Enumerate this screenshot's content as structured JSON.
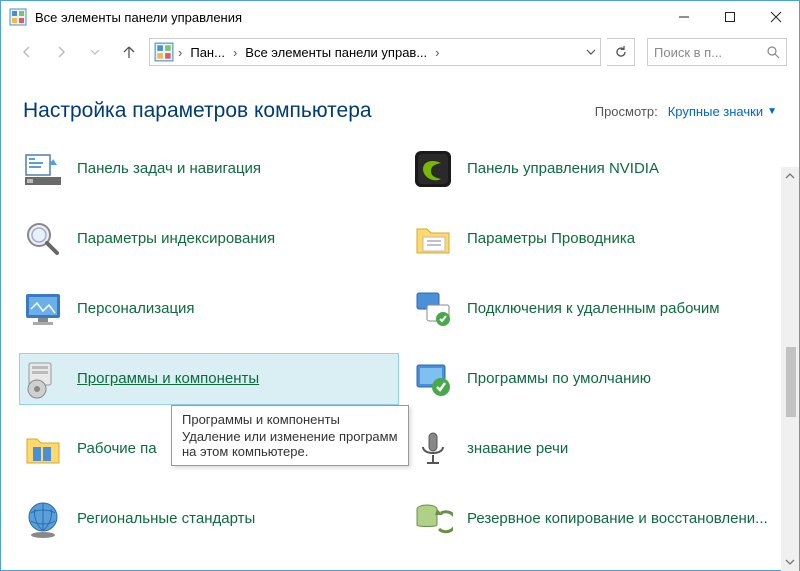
{
  "window": {
    "title": "Все элементы панели управления"
  },
  "breadcrumb": {
    "seg1": "Пан...",
    "seg2": "Все элементы панели управ..."
  },
  "nav": {
    "dropdown_chev": "⌄",
    "refresh_label": "↻"
  },
  "search": {
    "placeholder": "Поиск в п..."
  },
  "header": {
    "title": "Настройка параметров компьютера",
    "view_label": "Просмотр:",
    "view_value": "Крупные значки"
  },
  "items": [
    {
      "label": "Панель задач и навигация"
    },
    {
      "label": "Панель управления NVIDIA"
    },
    {
      "label": "Параметры индексирования"
    },
    {
      "label": "Параметры Проводника"
    },
    {
      "label": "Персонализация"
    },
    {
      "label": "Подключения к удаленным рабочим"
    },
    {
      "label": "Программы и компоненты"
    },
    {
      "label": "Программы по умолчанию"
    },
    {
      "label": "Рабочие па"
    },
    {
      "label": "знавание речи"
    },
    {
      "label": "Региональные стандарты"
    },
    {
      "label": "Резервное копирование и восстановлени..."
    }
  ],
  "tooltip": {
    "title": "Программы и компоненты",
    "body1": "Удаление или изменение программ",
    "body2": "на этом компьютере."
  }
}
